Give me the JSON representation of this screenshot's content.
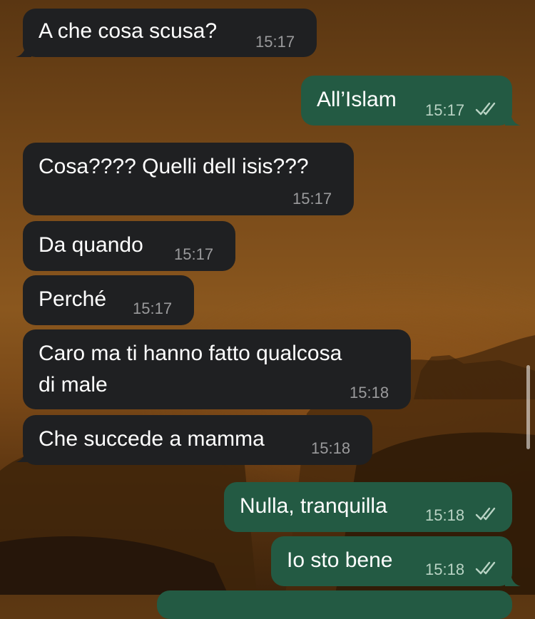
{
  "messages": [
    {
      "text": "A che cosa scusa?",
      "time": "15:17",
      "direction": "incoming"
    },
    {
      "text": "All’Islam",
      "time": "15:17",
      "direction": "outgoing",
      "status_icon": "double-check-icon"
    },
    {
      "text": "Cosa???? Quelli dell isis???",
      "time": "15:17",
      "direction": "incoming"
    },
    {
      "text": "Da quando",
      "time": "15:17",
      "direction": "incoming"
    },
    {
      "text": "Perché",
      "time": "15:17",
      "direction": "incoming"
    },
    {
      "text_line1": "Caro ma ti hanno fatto qualcosa",
      "text_line2": "di male",
      "time": "15:18",
      "direction": "incoming"
    },
    {
      "text": "Che succede a mamma",
      "time": "15:18",
      "direction": "incoming"
    },
    {
      "text": "Nulla, tranquilla",
      "time": "15:18",
      "direction": "outgoing",
      "status_icon": "double-check-icon"
    },
    {
      "text": "Io sto bene",
      "time": "15:18",
      "direction": "outgoing",
      "status_icon": "double-check-icon"
    }
  ],
  "colors": {
    "incoming_bubble": "#1f2022",
    "outgoing_bubble": "#235a43",
    "text": "#ffffff",
    "incoming_time": "#9a9a9c",
    "outgoing_time": "#b9d3c4"
  }
}
